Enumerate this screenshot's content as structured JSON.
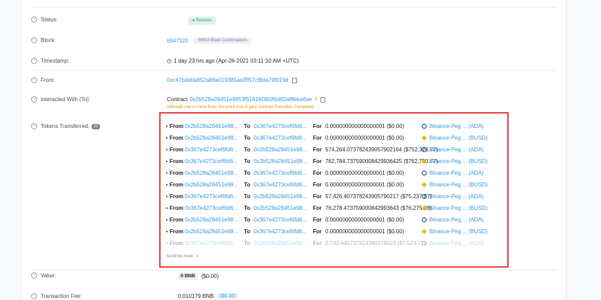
{
  "status": {
    "label": "Status:",
    "value": "Success"
  },
  "block": {
    "label": "Block:",
    "number": "6947320",
    "confirmations": "56503 Block Confirmations"
  },
  "timestamp": {
    "label": "Timestamp:",
    "value": "1 day 23 hrs ago (Apr-26-2021 03:11:10 AM +UTC)"
  },
  "from": {
    "label": "From:",
    "address": "0xc47bdd0a852a88a019385aa3ff57cf8da79f019d"
  },
  "interacted": {
    "label": "Interacted With (To):",
    "prefix": "Contract",
    "address": "0x2b528a28451e9853f51616f3b0f6d82af8bea6ae",
    "warning": "Although one or more Error Occurred [out of gas] Contract Execution Completed"
  },
  "tokens": {
    "label": "Tokens Transferred:",
    "count": "22",
    "from_word": "From",
    "to_word": "To",
    "for_word": "For",
    "rows": [
      {
        "from": "0x2b528a28451e98...",
        "to": "0x367e4273cef6fd6...",
        "amount": "0.000000000000000001 ($0.00)",
        "token": "ada",
        "token_label": "Binance-Peg ... (ADA)"
      },
      {
        "from": "0x2b528a28451e98...",
        "to": "0x367e4273cef6fd6...",
        "amount": "0.000000000000000001 ($0.00)",
        "token": "busd",
        "token_label": "Binance-Peg ... (BUSD)"
      },
      {
        "from": "0x367e4273cef6fd6...",
        "to": "0x2b528a28451e98...",
        "amount": "574,264.073782439057902164 ($752,376.72)",
        "token": "ada",
        "token_label": "Binance-Peg ... (ADA)"
      },
      {
        "from": "0x367e4273cef6fd6...",
        "to": "0x2b528a28451e98...",
        "amount": "762,784.737590008429936425 ($762,750.77)",
        "token": "busd",
        "token_label": "Binance-Peg ... (BUSD)"
      },
      {
        "from": "0x2b528a28451e98...",
        "to": "0x367e4273cef6fd6...",
        "amount": "0.000000000000000001 ($0.00)",
        "token": "ada",
        "token_label": "Binance-Peg ... (ADA)"
      },
      {
        "from": "0x2b528a28451e98...",
        "to": "0x367e4273cef6fd6...",
        "amount": "0.000000000000000001 ($0.00)",
        "token": "busd",
        "token_label": "Binance-Peg ... (BUSD)"
      },
      {
        "from": "0x367e4273cef6fd6...",
        "to": "0x2b528a28451e98...",
        "amount": "57,426.407378243905790217 ($75,237.67)",
        "token": "ada",
        "token_label": "Binance-Peg ... (ADA)"
      },
      {
        "from": "0x367e4273cef6fd6...",
        "to": "0x2b528a28451e98...",
        "amount": "76,278.473759000842993643 ($76,275.08)",
        "token": "busd",
        "token_label": "Binance-Peg ... (BUSD)"
      },
      {
        "from": "0x2b528a28451e98...",
        "to": "0x367e4273cef6fd6...",
        "amount": "0.000000000000000001 ($0.00)",
        "token": "ada",
        "token_label": "Binance-Peg ... (ADA)"
      },
      {
        "from": "0x2b528a28451e98...",
        "to": "0x367e4273cef6fd6...",
        "amount": "0.000000000000000001 ($0.00)",
        "token": "busd",
        "token_label": "Binance-Peg ... (BUSD)"
      },
      {
        "from": "0x367e4273cef6fd6...",
        "to": "0x2b528a28451e98...",
        "amount": "5,742.640737824390579023 ($7,523.77)",
        "token": "ada",
        "token_label": "Binance-Peg ... (ADA)"
      }
    ],
    "scroll_more": "Scroll for more"
  },
  "value": {
    "label": "Value:",
    "amount": "0 BNB",
    "usd": "($0.00)"
  },
  "fee": {
    "label": "Transaction Fee:",
    "amount": "0.010179 BNB",
    "usd": "($6.16)"
  },
  "icons": {
    "success": "check-circle-icon",
    "clock": "clock-icon",
    "copy": "copy-icon",
    "info": "question-circle-icon",
    "warning": "exclamation-icon",
    "caret": "caret-right-icon",
    "scroll": "chevron-double-down-icon"
  },
  "colors": {
    "link": "#3498db",
    "success": "#00a186",
    "warning": "#db9a04",
    "highlight": "#e53935"
  }
}
